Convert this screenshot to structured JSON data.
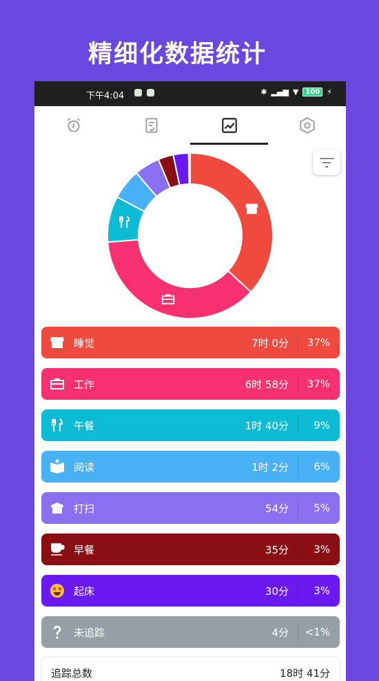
{
  "promo": {
    "title": "精细化数据统计"
  },
  "status_bar": {
    "time": "下午4:04",
    "battery": "100"
  },
  "tabs": [
    {
      "icon": "alarm-clock-icon"
    },
    {
      "icon": "checklist-icon"
    },
    {
      "icon": "chart-icon",
      "active": true
    },
    {
      "icon": "settings-icon"
    }
  ],
  "chart_data": {
    "type": "pie",
    "variant": "donut",
    "categories": [
      "睡觉",
      "工作",
      "午餐",
      "阅读",
      "打扫",
      "早餐",
      "起床",
      "未追踪"
    ],
    "values": [
      37,
      37,
      9,
      6,
      5,
      3,
      3,
      0.3
    ],
    "colors": [
      "#f04a3e",
      "#f7306f",
      "#0bbcd4",
      "#48b0f5",
      "#8a70f0",
      "#8a0f13",
      "#6a1af0",
      "#d0d0d0"
    ]
  },
  "rows": [
    {
      "label": "睡觉",
      "time": "7时 0分",
      "pct": "37%",
      "color": "#f04a3e",
      "icon": "store-icon"
    },
    {
      "label": "工作",
      "time": "6时 58分",
      "pct": "37%",
      "color": "#f7306f",
      "icon": "briefcase-icon"
    },
    {
      "label": "午餐",
      "time": "1时 40分",
      "pct": "9%",
      "color": "#0bbcd4",
      "icon": "cutlery-icon"
    },
    {
      "label": "阅读",
      "time": "1时 2分",
      "pct": "6%",
      "color": "#48b0f5",
      "icon": "book-icon"
    },
    {
      "label": "打扫",
      "time": "54分",
      "pct": "5%",
      "color": "#8a70f0",
      "icon": "box-icon"
    },
    {
      "label": "早餐",
      "time": "35分",
      "pct": "3%",
      "color": "#8a0f13",
      "icon": "coffee-icon"
    },
    {
      "label": "起床",
      "time": "30分",
      "pct": "3%",
      "color": "#6a1af0",
      "icon": "star-eyes-emoji-icon"
    },
    {
      "label": "未追踪",
      "time": "4分",
      "pct": "<1%",
      "color": "#94a0a6",
      "icon": "question-icon"
    }
  ],
  "total": {
    "label": "追踪总数",
    "value": "18时 41分"
  }
}
